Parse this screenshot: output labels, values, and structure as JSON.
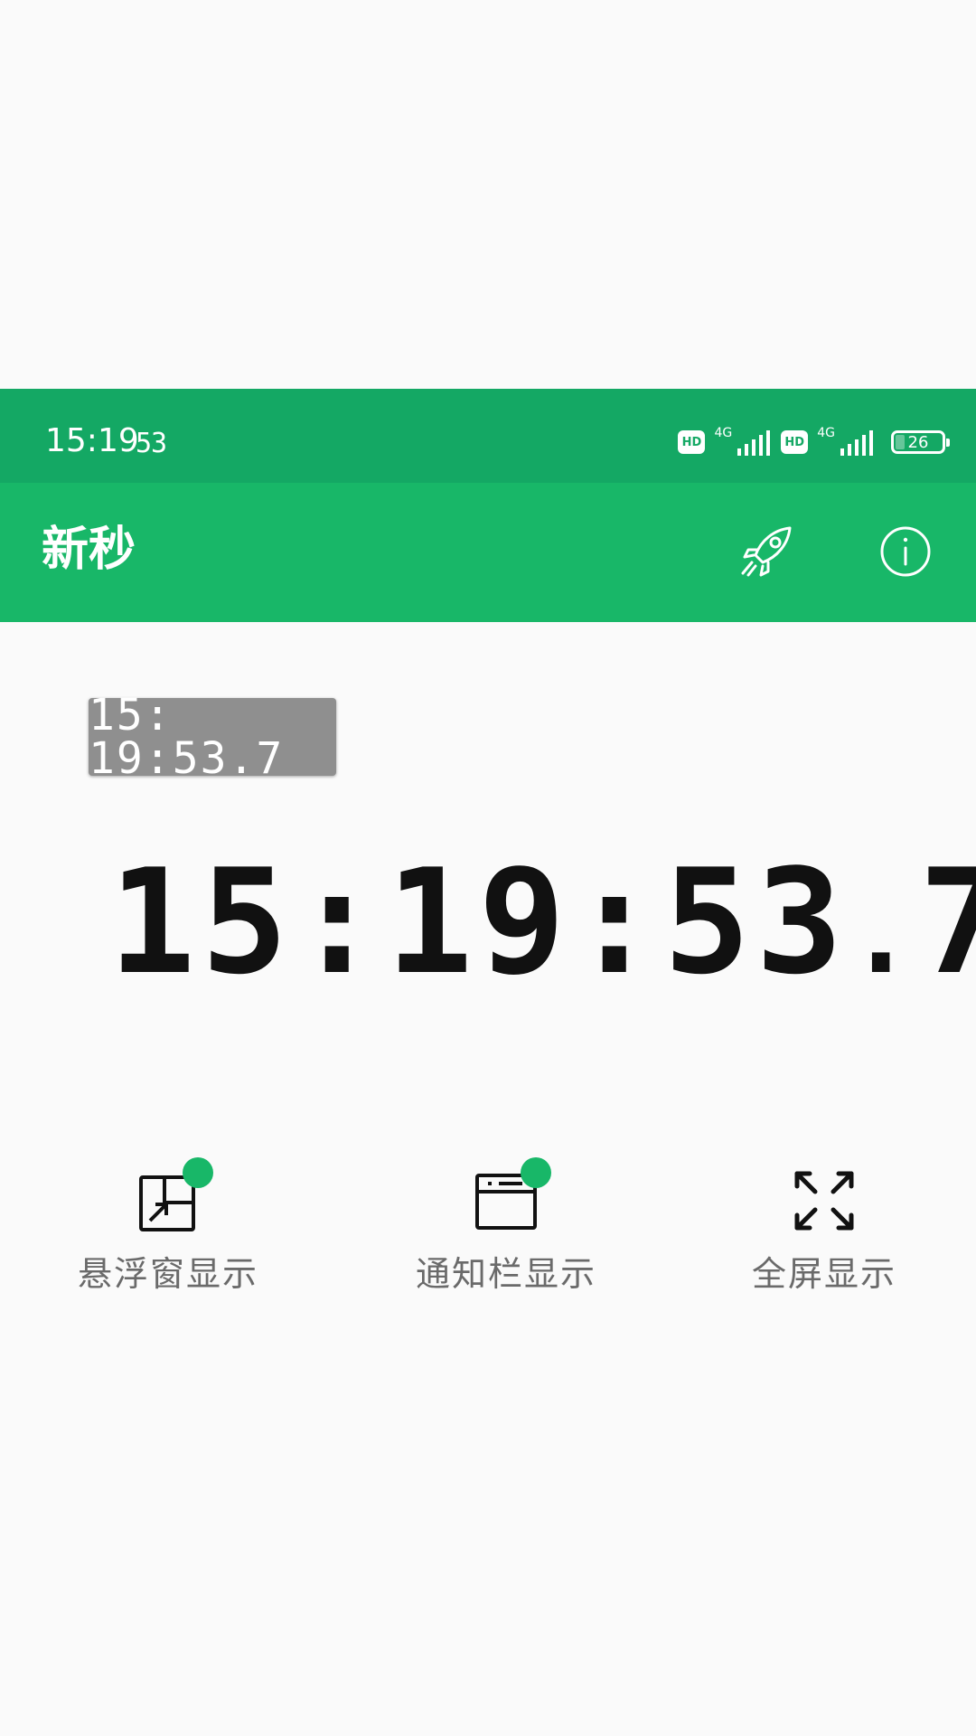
{
  "status_bar": {
    "time": "15:19",
    "seconds": "53",
    "network_1": "4G",
    "network_2": "4G",
    "hd_1": "HD",
    "hd_2": "HD",
    "battery_level": 26,
    "battery_text": "26"
  },
  "app_bar": {
    "title": "新秒",
    "actions": [
      {
        "icon": "rocket-icon"
      },
      {
        "icon": "info-icon"
      }
    ]
  },
  "mini_clock": {
    "time": "15: 19:53.7"
  },
  "main_clock": {
    "hours": "15",
    "minutes": "19",
    "seconds": "53",
    "tenths": "7",
    "separator": ":"
  },
  "modes": [
    {
      "label": "悬浮窗显示",
      "icon": "floating-window-icon",
      "enabled": true
    },
    {
      "label": "通知栏显示",
      "icon": "notification-bar-icon",
      "enabled": true
    },
    {
      "label": "全屏显示",
      "icon": "fullscreen-icon",
      "enabled": false
    }
  ],
  "colors": {
    "primary": "#18b768",
    "status_bar": "#14a864",
    "background": "#fafafa",
    "mini_clock_bg": "#8f8f8f",
    "text_secondary": "#6a6a6a"
  }
}
